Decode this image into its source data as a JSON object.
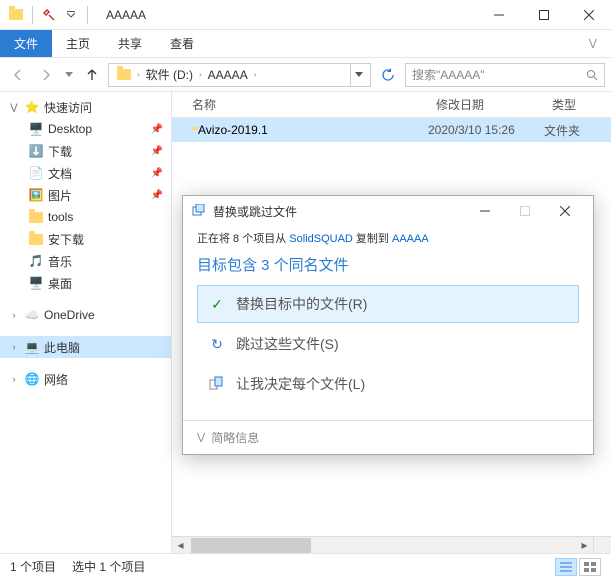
{
  "window": {
    "title": "AAAAA"
  },
  "ribbon": {
    "file": "文件",
    "home": "主页",
    "share": "共享",
    "view": "查看"
  },
  "addressbar": {
    "crumb1": "软件 (D:)",
    "crumb2": "AAAAA"
  },
  "search": {
    "placeholder": "搜索\"AAAAA\""
  },
  "sidebar": {
    "quick_access": "快速访问",
    "items": [
      "Desktop",
      "下载",
      "文档",
      "图片",
      "tools",
      "安下载",
      "音乐",
      "桌面"
    ],
    "onedrive": "OneDrive",
    "this_pc": "此电脑",
    "network": "网络"
  },
  "columns": {
    "name": "名称",
    "date": "修改日期",
    "type": "类型"
  },
  "rows": [
    {
      "name": "Avizo-2019.1",
      "date": "2020/3/10 15:26",
      "type": "文件夹"
    }
  ],
  "status": {
    "items": "1 个项目",
    "selected": "选中 1 个项目"
  },
  "dialog": {
    "title": "替换或跳过文件",
    "src_prefix": "正在将 8 个项目从 ",
    "src_link1": "SolidSQUAD",
    "src_mid": " 复制到 ",
    "src_link2": "AAAAA",
    "heading": "目标包含 3 个同名文件",
    "opt_replace": "替换目标中的文件(R)",
    "opt_skip": "跳过这些文件(S)",
    "opt_compare": "让我决定每个文件(L)",
    "details": "简略信息"
  }
}
